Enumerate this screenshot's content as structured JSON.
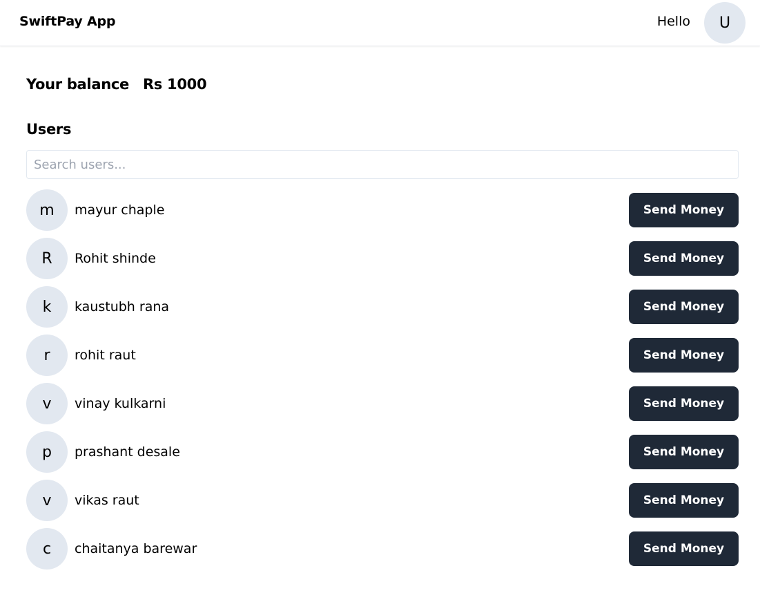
{
  "header": {
    "brand": "SwiftPay App",
    "greeting": "Hello",
    "avatar_initial": "U"
  },
  "balance": {
    "label": "Your balance",
    "amount": "Rs 1000"
  },
  "users": {
    "title": "Users",
    "search_placeholder": "Search users...",
    "send_label": "Send Money",
    "list": [
      {
        "initial": "m",
        "name": "mayur chaple"
      },
      {
        "initial": "R",
        "name": "Rohit shinde"
      },
      {
        "initial": "k",
        "name": "kaustubh rana"
      },
      {
        "initial": "r",
        "name": "rohit raut"
      },
      {
        "initial": "v",
        "name": "vinay kulkarni"
      },
      {
        "initial": "p",
        "name": "prashant desale"
      },
      {
        "initial": "v",
        "name": "vikas raut"
      },
      {
        "initial": "c",
        "name": "chaitanya barewar"
      }
    ]
  },
  "colors": {
    "button_bg": "#1f2937",
    "avatar_bg": "#e2e8f0"
  }
}
